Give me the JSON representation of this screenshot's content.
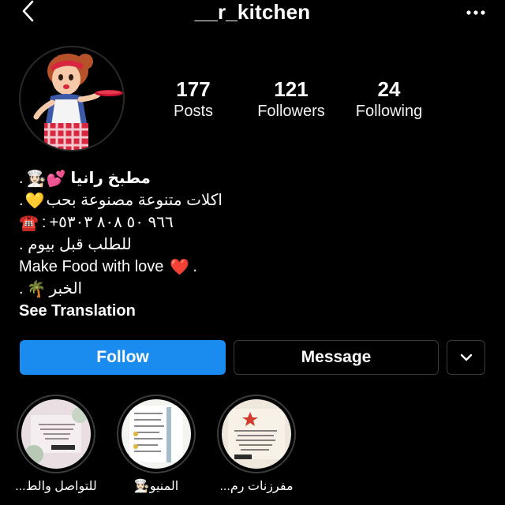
{
  "header": {
    "username": "__r_kitchen"
  },
  "stats": {
    "posts_count": "177",
    "posts_label": "Posts",
    "followers_count": "121",
    "followers_label": "Followers",
    "following_count": "24",
    "following_label": "Following"
  },
  "bio": {
    "name": "مطبخ رانيا",
    "name_emoji": "👩🏻‍🍳💕",
    "line2_text": "اكلات متنوعة مصنوعة بحب",
    "line2_emoji": "💛",
    "phone": "+٩٦٦ ٥٠ ٨٠٨ ٥٣٠٣",
    "phone_icon": "☎️",
    "line4": "للطلب قبل بيوم .",
    "line5": "Make Food with love",
    "heart": "❤️",
    "line6_text": "الخبر",
    "palm": "🌴",
    "see_translation": "See Translation"
  },
  "actions": {
    "follow_label": "Follow",
    "message_label": "Message"
  },
  "highlights": [
    {
      "label": "للتواصل والط..."
    },
    {
      "label": "المنيو👩🏻‍🍳"
    },
    {
      "label": "مفرزنات رم..."
    }
  ],
  "colors": {
    "background": "#000000",
    "follow_blue": "#1a8cf0",
    "border": "#3a3a3a"
  }
}
